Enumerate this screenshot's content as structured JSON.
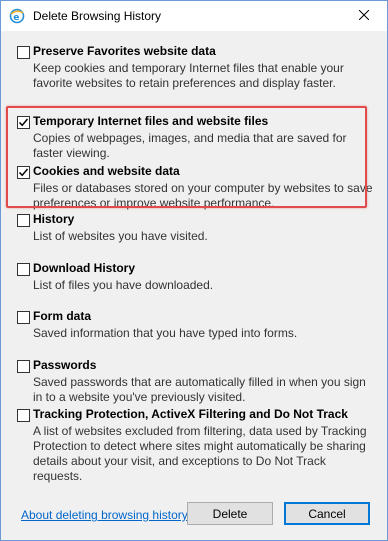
{
  "window": {
    "title": "Delete Browsing History"
  },
  "options": [
    {
      "label": "Preserve Favorites website data",
      "description": "Keep cookies and temporary Internet files that enable your favorite websites to retain preferences and display faster.",
      "checked": false
    },
    {
      "label": "Temporary Internet files and website files",
      "description": "Copies of webpages, images, and media that are saved for faster viewing.",
      "checked": true
    },
    {
      "label": "Cookies and website data",
      "description": "Files or databases stored on your computer by websites to save preferences or improve website performance.",
      "checked": true
    },
    {
      "label": "History",
      "description": "List of websites you have visited.",
      "checked": false
    },
    {
      "label": "Download History",
      "description": "List of files you have downloaded.",
      "checked": false
    },
    {
      "label": "Form data",
      "description": "Saved information that you have typed into forms.",
      "checked": false
    },
    {
      "label": "Passwords",
      "description": "Saved passwords that are automatically filled in when you sign in to a website you've previously visited.",
      "checked": false
    },
    {
      "label": "Tracking Protection, ActiveX Filtering and Do Not Track",
      "description": "A list of websites excluded from filtering, data used by Tracking Protection to detect where sites might automatically be sharing details about your visit, and exceptions to Do Not Track requests.",
      "checked": false
    }
  ],
  "footer": {
    "link_label": "About deleting browsing history",
    "delete_label": "Delete",
    "cancel_label": "Cancel"
  },
  "colors": {
    "highlight": "#e24b4b",
    "link": "#0066cc",
    "focus": "#0078d7"
  }
}
